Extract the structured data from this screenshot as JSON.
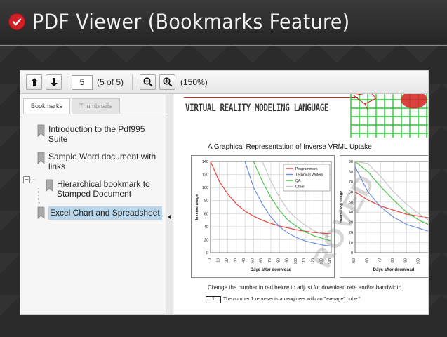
{
  "banner": {
    "title": "PDF Viewer (Bookmarks Feature)",
    "icon": "checkmark-circle-icon",
    "accent": "#d11f26"
  },
  "toolbar": {
    "page_value": "5",
    "page_count": "(5 of 5)",
    "zoom_level": "(150%)",
    "icons": [
      "arrow-up-icon",
      "arrow-down-icon",
      "zoom-out-icon",
      "zoom-in-icon"
    ]
  },
  "sidebar": {
    "tabs": [
      {
        "label": "Bookmarks",
        "active": true
      },
      {
        "label": "Thumbnails",
        "active": false
      }
    ],
    "bookmarks": [
      {
        "label": "Introduction to the Pdf995 Suite",
        "level": 0
      },
      {
        "label": "Sample Word document with links",
        "level": 0,
        "expanded": true
      },
      {
        "label": "Hierarchical bookmark to Stamped Document",
        "level": 1
      },
      {
        "label": "Excel Chart and Spreadsheet",
        "level": 0,
        "selected": true
      }
    ]
  },
  "document": {
    "heading": "VIRTUAL REALITY MODELING LANGUAGE",
    "chart_title": "A Graphical Representation of Inverse VRML Uptake",
    "note": "Change the number in red below to adjust for download rate and/or bandwidth.",
    "input_value": "1",
    "note2": "The number 1 represents an engineer with an \"average\" cube \"",
    "watermark": "ROVED"
  },
  "chart_data": [
    {
      "type": "line",
      "x": [
        0,
        10,
        20,
        30,
        40,
        50,
        60,
        70,
        80,
        90,
        100,
        110,
        120,
        130,
        140
      ],
      "xlabel": "Days after download",
      "ylabel": "Inverse usage",
      "ylim": [
        0,
        140
      ],
      "yticks": [
        0,
        20,
        40,
        60,
        80,
        100,
        120,
        140
      ],
      "legend": "top-right",
      "series": [
        {
          "name": "Programmers",
          "color": "#e8413b",
          "values": [
            140,
            110,
            90,
            75,
            64,
            56,
            50,
            45,
            41,
            38,
            35,
            33,
            31,
            30,
            29
          ]
        },
        {
          "name": "Technical Writers",
          "color": "#6c8fe0",
          "values": [
            null,
            null,
            null,
            null,
            140,
            100,
            75,
            55,
            40,
            30,
            23,
            18,
            15,
            12,
            10
          ]
        },
        {
          "name": "QA",
          "color": "#4cc24c",
          "values": [
            null,
            null,
            null,
            null,
            null,
            140,
            110,
            85,
            65,
            50,
            40,
            32,
            26,
            22,
            18
          ]
        },
        {
          "name": "Other",
          "color": "#c8c8c8",
          "values": [
            null,
            null,
            null,
            null,
            null,
            null,
            140,
            110,
            85,
            65,
            52,
            42,
            34,
            28,
            24
          ]
        }
      ]
    },
    {
      "type": "line",
      "x": [
        50,
        60,
        70,
        80,
        90,
        100,
        110
      ],
      "xlabel": "Days after download",
      "ylabel": "Inverse log usage",
      "ylim": [
        0,
        90
      ],
      "yticks": [
        0,
        10,
        20,
        30,
        40,
        50,
        60,
        70,
        80,
        90
      ],
      "series": [
        {
          "name": "",
          "color": "#e8413b",
          "values": [
            60,
            52,
            46,
            42,
            38,
            36,
            34
          ]
        },
        {
          "name": "",
          "color": "#6c8fe0",
          "values": [
            85,
            60,
            45,
            35,
            28,
            24,
            20
          ]
        },
        {
          "name": "",
          "color": "#4cc24c",
          "values": [
            90,
            80,
            65,
            52,
            40,
            32,
            26
          ]
        },
        {
          "name": "",
          "color": "#c8c8c8",
          "values": [
            90,
            88,
            75,
            60,
            48,
            38,
            30
          ]
        }
      ]
    }
  ]
}
